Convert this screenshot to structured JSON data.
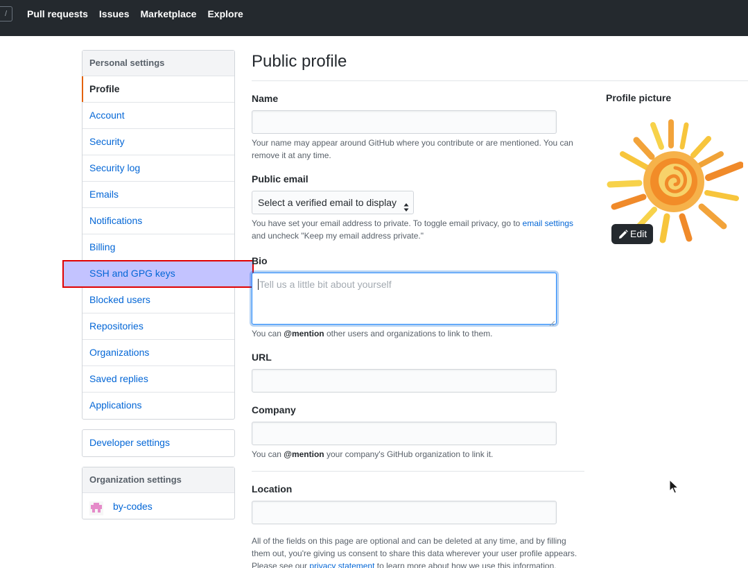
{
  "header": {
    "slash_key": "/",
    "nav": [
      "Pull requests",
      "Issues",
      "Marketplace",
      "Explore"
    ]
  },
  "sidebar": {
    "personal_heading": "Personal settings",
    "items": [
      {
        "label": "Profile",
        "state": "selected"
      },
      {
        "label": "Account"
      },
      {
        "label": "Security"
      },
      {
        "label": "Security log"
      },
      {
        "label": "Emails"
      },
      {
        "label": "Notifications"
      },
      {
        "label": "Billing"
      },
      {
        "label": "SSH and GPG keys",
        "state": "highlighted"
      },
      {
        "label": "Blocked users"
      },
      {
        "label": "Repositories"
      },
      {
        "label": "Organizations"
      },
      {
        "label": "Saved replies"
      },
      {
        "label": "Applications"
      }
    ],
    "developer_settings": "Developer settings",
    "org_heading": "Organization settings",
    "org_name": "by-codes"
  },
  "main": {
    "title": "Public profile",
    "name_label": "Name",
    "name_value": "",
    "name_note": "Your name may appear around GitHub where you contribute or are mentioned. You can remove it at any time.",
    "email_label": "Public email",
    "email_select": "Select a verified email to display",
    "email_note_pre": "You have set your email address to private. To toggle email privacy, go to ",
    "email_note_link": "email settings",
    "email_note_post": " and uncheck \"Keep my email address private.\"",
    "bio_label": "Bio",
    "bio_placeholder": "Tell us a little bit about yourself",
    "bio_note_pre": "You can ",
    "bio_note_mention": "@mention",
    "bio_note_post": " other users and organizations to link to them.",
    "url_label": "URL",
    "company_label": "Company",
    "company_note_pre": "You can ",
    "company_note_mention": "@mention",
    "company_note_post": " your company's GitHub organization to link it.",
    "location_label": "Location",
    "footer_note_1": "All of the fields on this page are optional and can be deleted at any time, and by filling",
    "footer_note_2": "them out, you're giving us consent to share this data wherever your user profile appears.",
    "footer_note_3_pre": "Please see our ",
    "footer_note_3_link": "privacy statement",
    "footer_note_3_post": " to learn more about how we use this information."
  },
  "profile_picture": {
    "label": "Profile picture",
    "edit_label": "Edit"
  },
  "colors": {
    "header_bg": "#24292e",
    "link": "#0366d6",
    "selected_accent": "#e36209",
    "highlight_fill": "#c3c3ff",
    "highlight_border": "#e00000"
  },
  "icons": [
    "pencil-icon",
    "select-arrows-icon",
    "mouse-cursor-icon",
    "org-avatar-icon"
  ]
}
